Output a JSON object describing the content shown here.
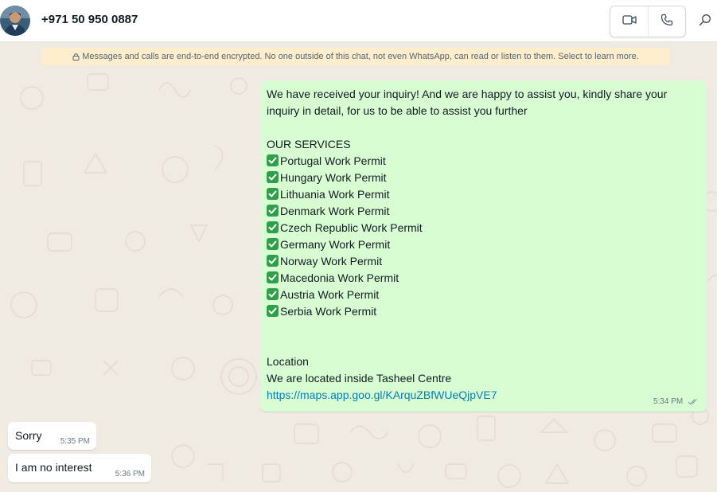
{
  "header": {
    "contact_name": "+971 50 950 0887",
    "video_call_icon": "video-camera-icon",
    "voice_call_icon": "phone-icon",
    "search_icon": "search-icon"
  },
  "encryption_notice": "Messages and calls are end-to-end encrypted. No one outside of this chat, not even WhatsApp, can read or listen to them. Select to learn more.",
  "outgoing_message": {
    "intro_line1": "We have received your inquiry! And we are happy to assist you, kindly share your",
    "intro_line2": "inquiry in detail, for us to be able to assist you further",
    "services_heading": "OUR SERVICES",
    "services": [
      "Portugal Work Permit",
      "Hungary Work Permit",
      "Lithuania Work Permit",
      "Denmark Work Permit",
      "Czech Republic Work Permit",
      "Germany Work Permit",
      "Norway Work Permit",
      "Macedonia Work Permit",
      "Austria Work Permit",
      "Serbia Work Permit"
    ],
    "location_heading": "Location",
    "location_text": "We are located inside Tasheel Centre",
    "map_link": "https://maps.app.goo.gl/KArquZBfWUeQjpVE7",
    "time": "5:34 PM",
    "status_icon": "double-check-icon"
  },
  "incoming_messages": [
    {
      "text": "Sorry",
      "time": "5:35 PM"
    },
    {
      "text": "I am no interest",
      "time": "5:36 PM"
    }
  ],
  "colors": {
    "chat_background": "#efeae2",
    "outgoing_bubble": "#d9fdd3",
    "incoming_bubble": "#ffffff",
    "encryption_banner": "#ffeecd",
    "link": "#027eb5",
    "checkmark": "#2fa04a"
  }
}
